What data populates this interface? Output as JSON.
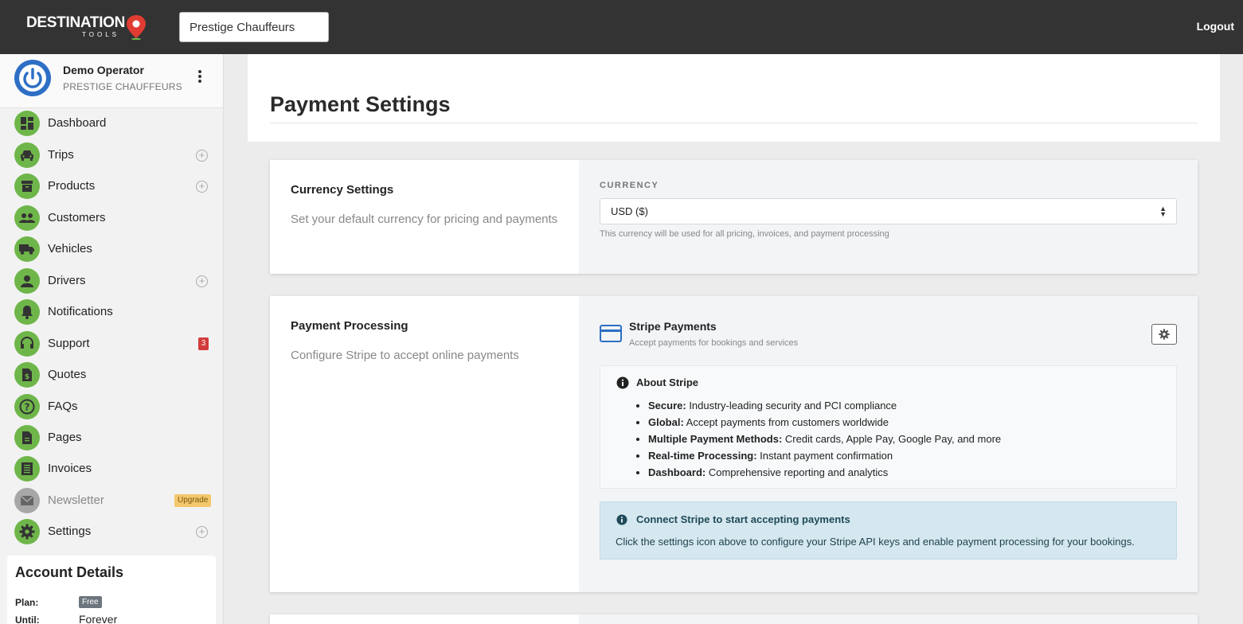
{
  "header": {
    "logo_main": "DESTINATION",
    "logo_sub": "TOOLS",
    "company_value": "Prestige Chauffeurs",
    "logout_label": "Logout"
  },
  "profile": {
    "name": "Demo Operator",
    "company": "PRESTIGE CHAUFFEURS"
  },
  "sidebar": {
    "items": [
      {
        "label": "Dashboard",
        "icon": "dashboard-icon"
      },
      {
        "label": "Trips",
        "icon": "car-icon"
      },
      {
        "label": "Products",
        "icon": "archive-icon"
      },
      {
        "label": "Customers",
        "icon": "users-icon"
      },
      {
        "label": "Vehicles",
        "icon": "truck-icon"
      },
      {
        "label": "Drivers",
        "icon": "user-icon"
      },
      {
        "label": "Notifications",
        "icon": "bell-icon"
      },
      {
        "label": "Support",
        "icon": "headset-icon",
        "badge": "3"
      },
      {
        "label": "Quotes",
        "icon": "dollar-file-icon"
      },
      {
        "label": "FAQs",
        "icon": "question-icon"
      },
      {
        "label": "Pages",
        "icon": "file-icon"
      },
      {
        "label": "Invoices",
        "icon": "receipt-icon"
      },
      {
        "label": "Newsletter",
        "icon": "envelope-icon",
        "badge": "Upgrade"
      },
      {
        "label": "Settings",
        "icon": "gear-icon"
      }
    ]
  },
  "account": {
    "title": "Account Details",
    "plan_label": "Plan:",
    "plan_value": "Free",
    "until_label": "Until:",
    "until_value": "Forever"
  },
  "page": {
    "title": "Payment Settings"
  },
  "currency_card": {
    "heading": "Currency Settings",
    "description": "Set your default currency for pricing and payments",
    "field_label": "CURRENCY",
    "selected": "USD ($)",
    "hint": "This currency will be used for all pricing, invoices, and payment processing"
  },
  "payment_card": {
    "heading": "Payment Processing",
    "description": "Configure Stripe to accept online payments",
    "stripe_title": "Stripe Payments",
    "stripe_subtitle": "Accept payments for bookings and services",
    "about_title": "About Stripe",
    "about_items": [
      {
        "term": "Secure:",
        "text": " Industry-leading security and PCI compliance"
      },
      {
        "term": "Global:",
        "text": " Accept payments from customers worldwide"
      },
      {
        "term": "Multiple Payment Methods:",
        "text": " Credit cards, Apple Pay, Google Pay, and more"
      },
      {
        "term": "Real-time Processing:",
        "text": " Instant payment confirmation"
      },
      {
        "term": "Dashboard:",
        "text": " Comprehensive reporting and analytics"
      }
    ],
    "alert_title": "Connect Stripe to start accepting payments",
    "alert_text": "Click the settings icon above to configure your Stripe API keys and enable payment processing for your bookings."
  },
  "colors": {
    "topbar": "#333333",
    "nav_icon_green": "#6fb64a",
    "avatar_blue": "#2d6fc5",
    "badge_red": "#d23c3c",
    "upgrade_yellow": "#f3c76b",
    "alert_bg": "#d5e8ef"
  }
}
